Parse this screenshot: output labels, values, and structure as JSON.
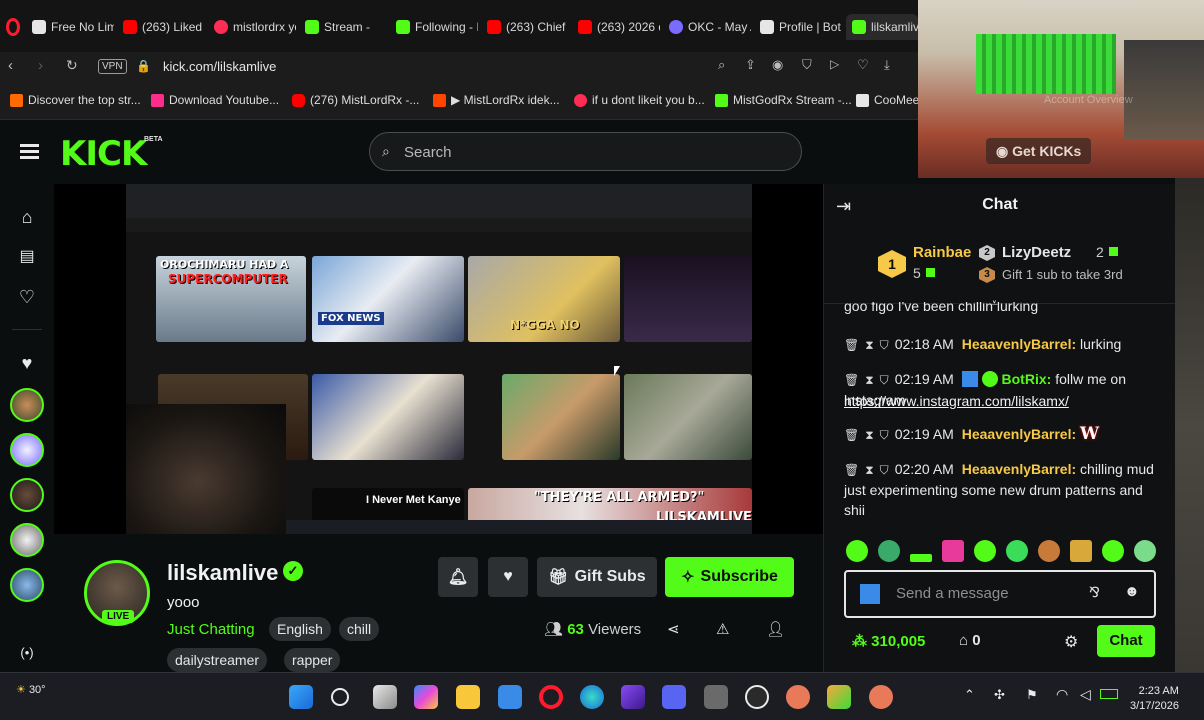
{
  "browser": {
    "tabs": [
      {
        "label": "Free No Lim",
        "color": "#e6e6e6"
      },
      {
        "label": "(263) Liked v",
        "color": "#ff0000"
      },
      {
        "label": "mistlordrx yo",
        "color": "#ff2d55"
      },
      {
        "label": "Stream -",
        "color": "#53fc18"
      },
      {
        "label": "Following - I",
        "color": "#53fc18"
      },
      {
        "label": "(263) Chief K",
        "color": "#ff0000"
      },
      {
        "label": "(263) 2026 d",
        "color": "#ff0000"
      },
      {
        "label": "OKC - May A",
        "color": "#7a6cff"
      },
      {
        "label": "Profile | Bot",
        "color": "#e6e6e6"
      },
      {
        "label": "lilskamlive Stream",
        "color": "#53fc18"
      }
    ],
    "vpn_label": "VPN",
    "url": "kick.com/lilskamlive",
    "bookmarks": [
      {
        "label": "Discover the top str...",
        "color": "#ff6a00"
      },
      {
        "label": "Download Youtube...",
        "color": "#ff2d8a"
      },
      {
        "label": "(276) MistLordRx -...",
        "color": "#ff0000"
      },
      {
        "label": "▶ MistLordRx idek...",
        "color": "#ff4500"
      },
      {
        "label": "if u dont likeit you b...",
        "color": "#ff2d55"
      },
      {
        "label": "MistGodRx Stream -...",
        "color": "#53fc18"
      },
      {
        "label": "CooMee",
        "color": "#e6e6e6"
      }
    ]
  },
  "kick": {
    "logo_text": "KICK",
    "logo_badge": "BETA",
    "search_placeholder": "Search",
    "get_kicks_label": "Get KICKs",
    "account_overview_label": "Account Overview"
  },
  "video": {
    "thumb_texts": [
      "OROCHIMARU HAD A",
      "SUPERCOMPUTER",
      "N*GGA NO",
      "I Never Met Kanye",
      "\"THEY'RE ALL ARMED?\"",
      "LILSKAMLIVE",
      "FOX NEWS"
    ]
  },
  "channel": {
    "name": "lilskamlive",
    "live_badge": "LIVE",
    "title": "yooo",
    "category": "Just Chatting",
    "tags": [
      "English",
      "chill",
      "dailystreamer",
      "rapper"
    ],
    "gift_subs_label": "Gift Subs",
    "subscribe_label": "Subscribe",
    "viewers_count": "63",
    "viewers_label": "Viewers"
  },
  "chat": {
    "title": "Chat",
    "leaderboard": {
      "first_name": "Rainbae",
      "first_count": "5",
      "second_name": "LizyDeetz",
      "second_count": "2",
      "third_prompt": "Gift 1 sub to take 3rd"
    },
    "partial_line": "goo figo I've been chillin lurking",
    "messages": [
      {
        "time": "02:18 AM",
        "user": "HeaavenlyBarrel:",
        "text": "lurking"
      },
      {
        "time": "02:19 AM",
        "user": "BotRix:",
        "text": "follw me on instagram",
        "link": "https://www.instagram.com/lilskamx/"
      },
      {
        "time": "02:19 AM",
        "user": "HeaavenlyBarrel:",
        "text": "W"
      },
      {
        "time": "02:20 AM",
        "user": "HeaavenlyBarrel:",
        "text": "chilling mud just experimenting some new drum patterns and shii"
      }
    ],
    "input_placeholder": "Send a message",
    "points": "310,005",
    "gifts": "0",
    "send_label": "Chat"
  },
  "taskbar": {
    "weather": "30°",
    "time": "2:23 AM",
    "date": "3/17/2026"
  },
  "colors": {
    "kick_green": "#53fc18",
    "background": "#0b0e0f",
    "username_gold": "#f7c948"
  }
}
